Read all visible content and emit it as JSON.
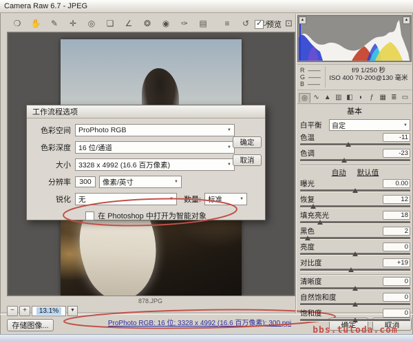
{
  "window": {
    "title": "Camera Raw 6.7 -  JPEG"
  },
  "toolbar": {
    "tools": [
      {
        "name": "zoom-tool",
        "glyph": "❍"
      },
      {
        "name": "hand-tool",
        "glyph": "✋"
      },
      {
        "name": "white-balance-tool",
        "glyph": "✎"
      },
      {
        "name": "color-sampler-tool",
        "glyph": "✛"
      },
      {
        "name": "targeted-adjustment-tool",
        "glyph": "◎"
      },
      {
        "name": "crop-tool",
        "glyph": "❏"
      },
      {
        "name": "straighten-tool",
        "glyph": "∠"
      },
      {
        "name": "spot-removal-tool",
        "glyph": "❂"
      },
      {
        "name": "red-eye-tool",
        "glyph": "◉"
      },
      {
        "name": "adjustment-brush-tool",
        "glyph": "✑"
      },
      {
        "name": "graduated-filter-tool",
        "glyph": "▤"
      },
      {
        "name": "preferences-button",
        "glyph": "≡"
      },
      {
        "name": "rotate-left-button",
        "glyph": "↺"
      },
      {
        "name": "rotate-right-button",
        "glyph": "↻"
      }
    ],
    "preview_checkbox_label": "预览",
    "fullscreen_glyph": "⊡"
  },
  "histogram": {
    "rgb": [
      {
        "label": "R",
        "value": "——"
      },
      {
        "label": "G",
        "value": "——"
      },
      {
        "label": "B",
        "value": "——"
      }
    ],
    "info_line1": "f/9   1/250 秒",
    "info_line2": "ISO 400   70-200@130 毫米"
  },
  "panel_tabs": [
    {
      "name": "tab-basic",
      "glyph": "◎"
    },
    {
      "name": "tab-tone-curve",
      "glyph": "∿"
    },
    {
      "name": "tab-detail",
      "glyph": "▲"
    },
    {
      "name": "tab-hsl-grayscale",
      "glyph": "▥"
    },
    {
      "name": "tab-split-toning",
      "glyph": "◧"
    },
    {
      "name": "tab-lens-corrections",
      "glyph": "◗"
    },
    {
      "name": "tab-effects",
      "glyph": "ƒ"
    },
    {
      "name": "tab-camera-calibration",
      "glyph": "▦"
    },
    {
      "name": "tab-presets",
      "glyph": "≣"
    },
    {
      "name": "tab-snapshots",
      "glyph": "▭"
    }
  ],
  "basic": {
    "title": "基本",
    "wb_label": "白平衡",
    "wb_value": "自定",
    "auto_link": "自动",
    "default_link": "默认值",
    "sliders": [
      {
        "label": "色温",
        "value": "-11",
        "thumb_pct": 44
      },
      {
        "label": "色调",
        "value": "-23",
        "thumb_pct": 40
      },
      {
        "label": "曝光",
        "value": "0.00",
        "thumb_pct": 50
      },
      {
        "label": "恢复",
        "value": "12",
        "thumb_pct": 12
      },
      {
        "label": "填充亮光",
        "value": "18",
        "thumb_pct": 18
      },
      {
        "label": "黑色",
        "value": "2",
        "thumb_pct": 7
      },
      {
        "label": "亮度",
        "value": "0",
        "thumb_pct": 50
      },
      {
        "label": "对比度",
        "value": "+19",
        "thumb_pct": 46
      },
      {
        "label": "清晰度",
        "value": "0",
        "thumb_pct": 50
      },
      {
        "label": "自然饱和度",
        "value": "0",
        "thumb_pct": 50
      },
      {
        "label": "饱和度",
        "value": "0",
        "thumb_pct": 50
      }
    ]
  },
  "watermark": "bbs.tuloda.com",
  "dialog": {
    "title": "工作流程选项",
    "color_space_label": "色彩空间",
    "color_space_value": "ProPhoto RGB",
    "color_depth_label": "色彩深度",
    "color_depth_value": "16 位/通道",
    "size_label": "大小",
    "size_value": "3328 x 4992 (16.6 百万像素)",
    "resolution_label": "分辨率",
    "resolution_value": "300",
    "resolution_unit": "像素/英寸",
    "sharpen_label": "锐化",
    "sharpen_value": "无",
    "amount_label": "数量:",
    "amount_value": "标准",
    "smart_object_label": "在 Photoshop 中打开为智能对象",
    "ok": "确定",
    "cancel": "取消"
  },
  "footer": {
    "filename": "878.JPG",
    "zoom_out": "−",
    "zoom_in": "+",
    "zoom_value": "13.1%",
    "save_button": "存储图像...",
    "workflow_link": "ProPhoto RGB: 16 位; 3328 x 4992 (16.6 百万像素); 300 ppi",
    "ok": "确定",
    "cancel": "取消"
  },
  "colors": {
    "annotation_red": "#c2504a",
    "link_blue": "#2b2b9e"
  }
}
